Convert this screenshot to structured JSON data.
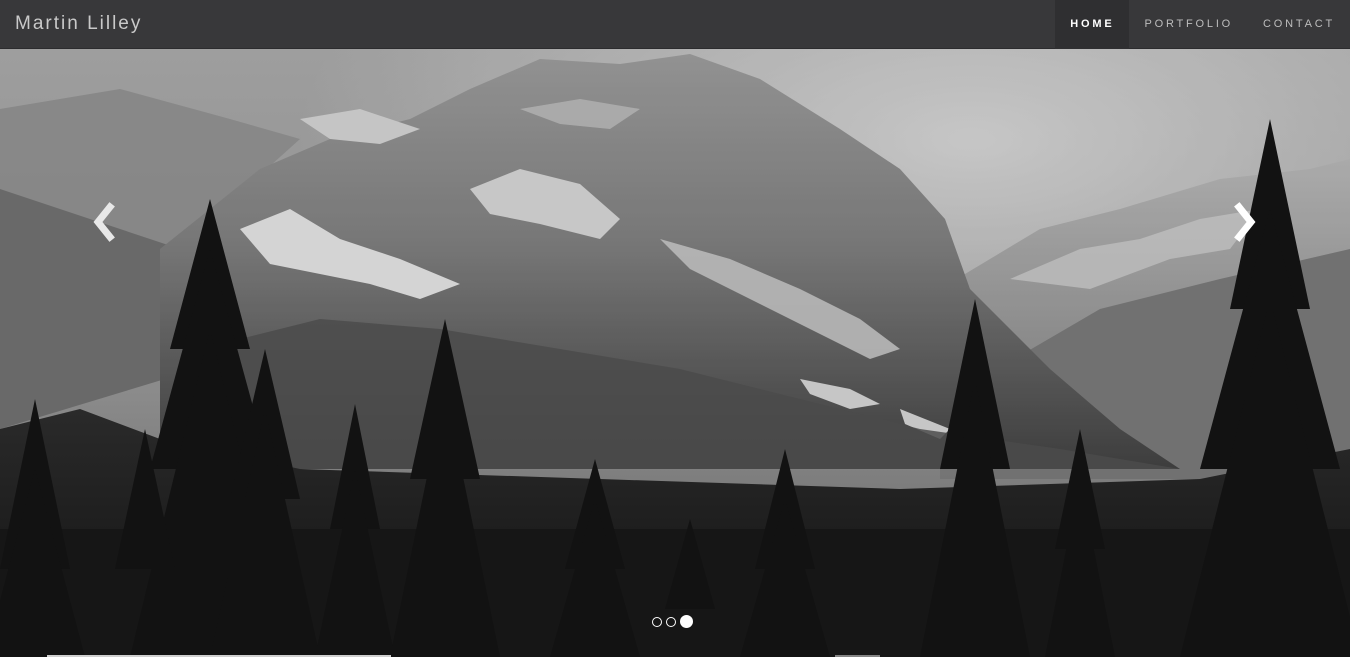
{
  "navbar": {
    "brand": "Martin Lilley",
    "items": [
      {
        "label": "HOME",
        "active": true
      },
      {
        "label": "PORTFOLIO",
        "active": false
      },
      {
        "label": "CONTACT",
        "active": false
      }
    ]
  },
  "carousel": {
    "slide_image": "black-and-white mountain landscape with pine forest",
    "prev_icon": "chevron-left-icon",
    "next_icon": "chevron-right-icon",
    "indicators": [
      {
        "active": false
      },
      {
        "active": false
      },
      {
        "active": true
      }
    ]
  },
  "colors": {
    "navbar_bg": "#38383a",
    "nav_active_bg": "#2f2f31",
    "nav_text": "#bdbdbd",
    "brand_text": "#c9c9c9"
  }
}
